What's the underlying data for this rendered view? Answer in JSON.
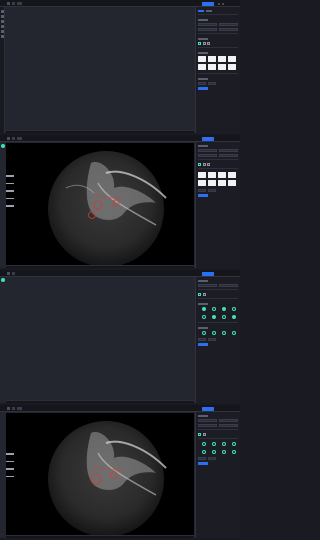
{
  "frames": [
    {
      "id": "frame-1",
      "variant": "empty-canvas"
    },
    {
      "id": "frame-2",
      "variant": "image-canvas"
    },
    {
      "id": "frame-3",
      "variant": "empty-canvas"
    },
    {
      "id": "frame-4",
      "variant": "image-canvas"
    }
  ],
  "icons": {
    "logo": "app-logo-icon",
    "gear": "gear-icon"
  },
  "colors": {
    "accent": "#2b6ff2",
    "teal": "#3ee0b4",
    "canvas": "#24262f",
    "panel": "#1c1d24"
  }
}
